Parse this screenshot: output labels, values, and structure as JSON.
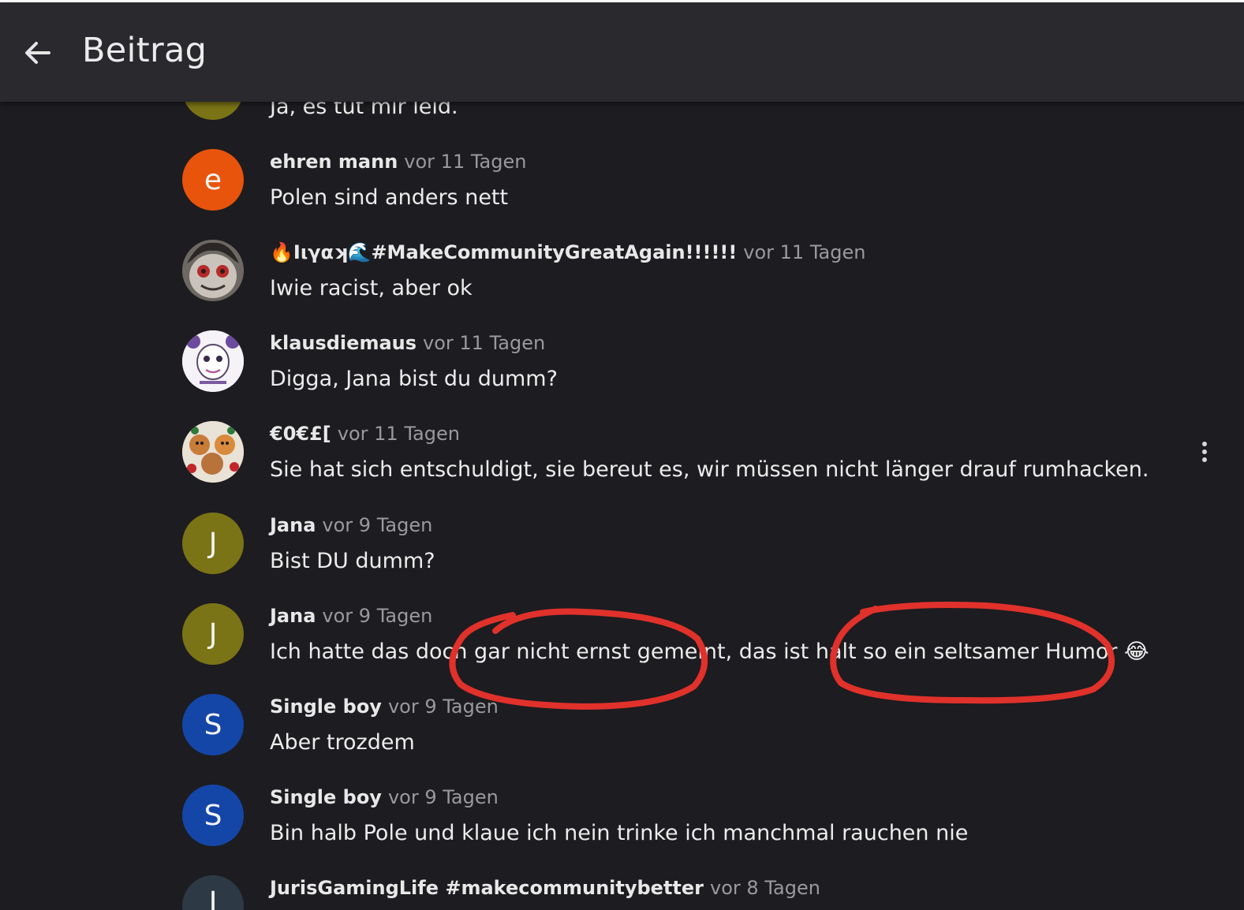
{
  "header": {
    "title": "Beitrag",
    "back_icon": "arrow-left-icon"
  },
  "comments": [
    {
      "author": "",
      "time": "",
      "text": "Ja, es tut mir leid.",
      "avatar_letter": "",
      "avatar_color": "#7b7416"
    },
    {
      "author": "ehren mann",
      "time": "vor 11 Tagen",
      "text": "Polen sind anders nett",
      "avatar_letter": "e",
      "avatar_color": "#e8540c"
    },
    {
      "author": "🔥Iιγαʞ🌊#MakeCommunityGreatAgain!!!!!!",
      "time": "vor 11 Tagen",
      "text": "Iwie racist, aber ok",
      "avatar_letter": "",
      "avatar_color": "#5b5550"
    },
    {
      "author": "klausdiemaus",
      "time": "vor 11 Tagen",
      "text": "Digga, Jana bist du dumm?",
      "avatar_letter": "",
      "avatar_color": "#f4f0f6"
    },
    {
      "author": "€0€£[",
      "time": "vor 11 Tagen",
      "text": "Sie hat sich entschuldigt, sie bereut es, wir müssen nicht länger drauf rumhacken.",
      "avatar_letter": "",
      "avatar_color": "#d9b38c"
    },
    {
      "author": "Jana",
      "time": "vor 9 Tagen",
      "text": "Bist DU dumm?",
      "avatar_letter": "J",
      "avatar_color": "#7b7416"
    },
    {
      "author": "Jana",
      "time": "vor 9 Tagen",
      "text": "Ich hatte das doch gar nicht ernst gemeint, das ist halt so ein seltsamer Humor 😂",
      "avatar_letter": "J",
      "avatar_color": "#7b7416"
    },
    {
      "author": "Single boy",
      "time": "vor 9 Tagen",
      "text": "Aber trozdem",
      "avatar_letter": "S",
      "avatar_color": "#1446a8"
    },
    {
      "author": "Single boy",
      "time": "vor 9 Tagen",
      "text": "Bin halb Pole und klaue ich nein trinke ich manchmal rauchen nie",
      "avatar_letter": "S",
      "avatar_color": "#1446a8"
    },
    {
      "author": "JurisGamingLife #makecommunitybetter",
      "time": "vor 8 Tagen",
      "text": "",
      "avatar_letter": "J",
      "avatar_color": "#2d3a45"
    }
  ],
  "more_icon": "more-vertical-icon",
  "annotation_color": "#e0312b"
}
